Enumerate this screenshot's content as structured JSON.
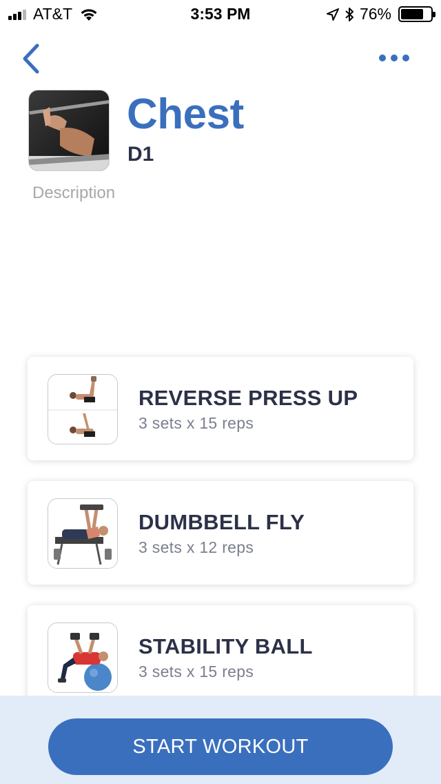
{
  "status_bar": {
    "carrier": "AT&T",
    "time": "3:53 PM",
    "battery_percent": "76%",
    "battery_level": 0.76,
    "signal_bars": 4,
    "signal_bars_filled": 3
  },
  "nav": {
    "back_icon": "chevron-left-icon",
    "more_icon": "ellipsis-horizontal-icon"
  },
  "header": {
    "title": "Chest",
    "subtitle": "D1",
    "description_placeholder": "Description"
  },
  "exercises": [
    {
      "name": "REVERSE PRESS UP",
      "detail": "3 sets x 15 reps"
    },
    {
      "name": "DUMBBELL FLY",
      "detail": "3 sets x 12 reps"
    },
    {
      "name": "STABILITY BALL",
      "detail": "3 sets x 15 reps"
    }
  ],
  "actions": {
    "start_label": "START WORKOUT"
  },
  "colors": {
    "accent": "#3a6fbd",
    "text_dark": "#2b3147",
    "text_muted": "#7b7f8e",
    "placeholder": "#a7a7ad",
    "bottom_bar_bg": "#e2ebf8"
  }
}
